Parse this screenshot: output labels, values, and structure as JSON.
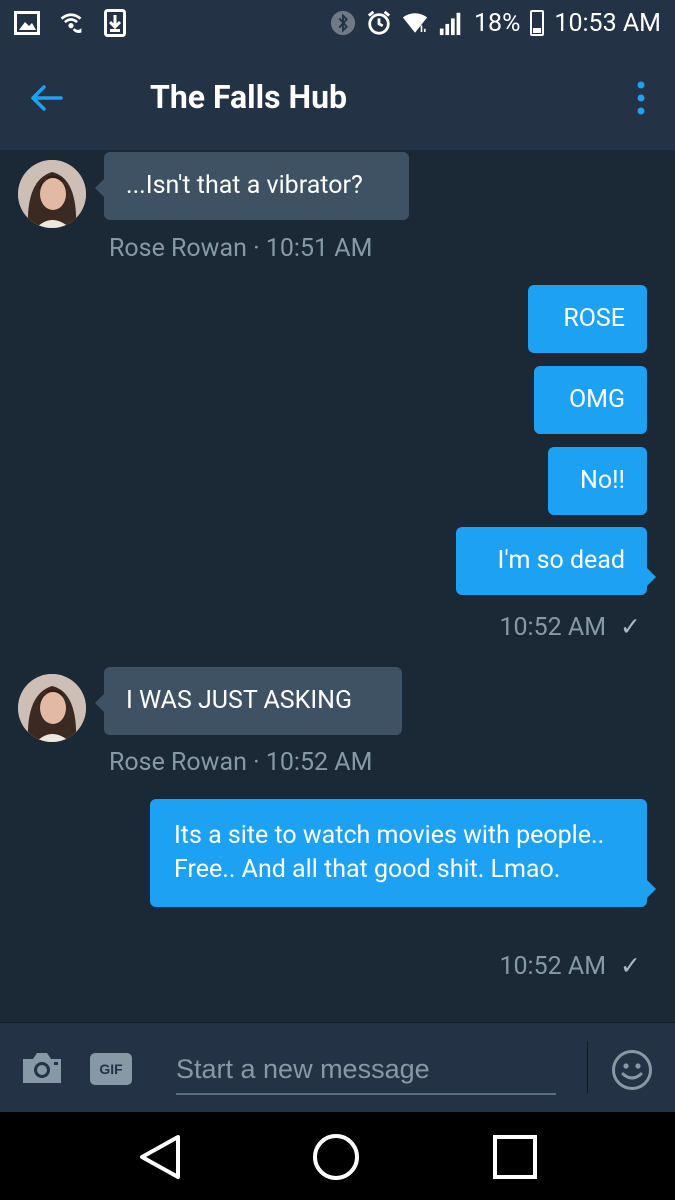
{
  "status_bar": {
    "battery": "18%",
    "time": "10:53 AM",
    "icons": [
      "image-icon",
      "wifi-calling-icon",
      "download-icon",
      "bluetooth-icon",
      "alarm-icon",
      "wifi-icon",
      "signal-icon",
      "battery-icon"
    ]
  },
  "header": {
    "title": "The Falls Hub",
    "back_icon": "arrow-left-icon",
    "menu_icon": "more-vertical-icon"
  },
  "messages": [
    {
      "direction": "in",
      "text": "...Isn't that a vibrator?",
      "meta": "Rose Rowan · 10:51 AM"
    },
    {
      "direction": "out",
      "text": "ROSE"
    },
    {
      "direction": "out",
      "text": "OMG"
    },
    {
      "direction": "out",
      "text": "No!!"
    },
    {
      "direction": "out",
      "text": "I'm so dead",
      "meta": "10:52 AM"
    },
    {
      "direction": "in",
      "text": "I WAS JUST ASKING",
      "meta": "Rose Rowan · 10:52 AM"
    },
    {
      "direction": "out",
      "text": "Its a site to watch movies with people.. Free.. And all that good shit. Lmao.",
      "meta": "10:52 AM"
    }
  ],
  "composer": {
    "placeholder": "Start a new message",
    "gif_label": "GIF",
    "camera_icon": "camera-icon",
    "emoji_icon": "emoji-icon"
  },
  "colors": {
    "background": "#1b2836",
    "bar": "#233244",
    "incoming_bubble": "#3f5264",
    "outgoing_bubble": "#1da1f2",
    "accent": "#1da1f2",
    "meta_text": "#8899a6"
  }
}
